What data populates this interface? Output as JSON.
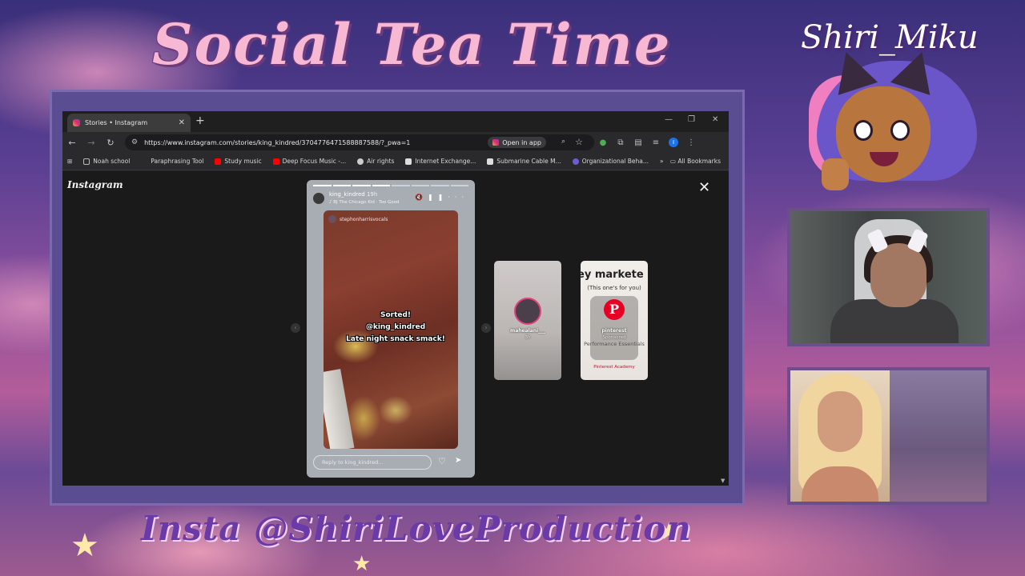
{
  "overlay": {
    "headline": "Social Tea Time",
    "brand_name": "Shiri_Miku",
    "handle_text": "Insta @ShiriLoveProduction"
  },
  "browser": {
    "tab_title": "Stories • Instagram",
    "new_tab_icon": "+",
    "url": "https://www.instagram.com/stories/king_kindred/3704776471588887588/?_pwa=1",
    "open_in_app_label": "Open in app",
    "profile_initial": "I",
    "bookmarks": [
      {
        "label": "Noah school",
        "color": "#8a8a8a"
      },
      {
        "label": "Paraphrasing Tool",
        "color": "#2a2a2d"
      },
      {
        "label": "Study music",
        "color": "#ff0000"
      },
      {
        "label": "Deep Focus Music -...",
        "color": "#ff0000"
      },
      {
        "label": "Air rights",
        "color": "#cccccc"
      },
      {
        "label": "Internet Exchange...",
        "color": "#dddddd"
      },
      {
        "label": "Submarine Cable M...",
        "color": "#dddddd"
      },
      {
        "label": "Organizational Beha...",
        "color": "#6b5dd3"
      }
    ],
    "all_bookmarks_label": "All Bookmarks"
  },
  "instagram": {
    "logo": "Instagram",
    "story": {
      "username": "king_kindred",
      "time": "19h",
      "song": "♪ BJ The Chicago Kid · Too Good",
      "credit": "stephonharrisvocals",
      "caption_lines": [
        "Sorted!",
        "@king_kindred",
        "Late night snack smack!"
      ],
      "reply_placeholder": "Reply to king_kindred..."
    },
    "next_stories": [
      {
        "username": "mahealani___",
        "time": "3h"
      },
      {
        "headline": "ey markete",
        "subline": "(This one's for you)",
        "logo_letter": "P",
        "username": "pinterest",
        "sponsored": "Sponsored",
        "feature_text": "Performance Essentials",
        "academy_label": "Pinterest Academy"
      }
    ]
  }
}
